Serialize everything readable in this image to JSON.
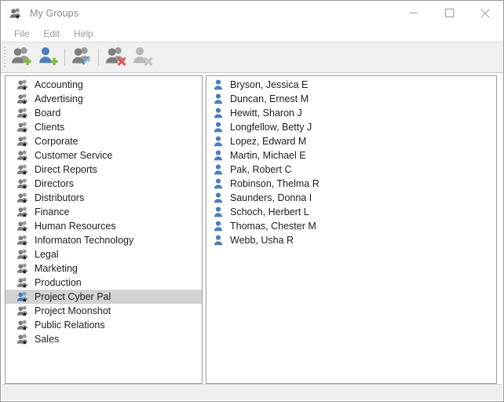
{
  "window": {
    "title": "My Groups",
    "title_icon": "group-star-icon",
    "controls": [
      {
        "name": "minimize-button",
        "glyph": "minimize-icon"
      },
      {
        "name": "maximize-button",
        "glyph": "maximize-icon"
      },
      {
        "name": "close-button",
        "glyph": "close-icon"
      }
    ]
  },
  "menubar": {
    "items": [
      {
        "label": "File"
      },
      {
        "label": "Edit"
      },
      {
        "label": "Help"
      }
    ]
  },
  "toolbar": {
    "buttons": [
      {
        "label": "Add Group",
        "icon": "add-group-icon",
        "enabled": true
      },
      {
        "label": "Add Member",
        "icon": "add-member-icon",
        "enabled": true
      },
      {
        "label": "Edit Group",
        "icon": "edit-group-icon",
        "enabled": true
      },
      {
        "label": "Delete Group",
        "icon": "delete-group-icon",
        "enabled": true
      },
      {
        "label": "Remove Member",
        "icon": "remove-member-icon",
        "enabled": false
      }
    ]
  },
  "groups_panel": {
    "name": "groups-list",
    "selected_index": 15,
    "items": [
      {
        "label": "Accounting"
      },
      {
        "label": "Advertising"
      },
      {
        "label": "Board"
      },
      {
        "label": "Clients"
      },
      {
        "label": "Corporate"
      },
      {
        "label": "Customer Service"
      },
      {
        "label": "Direct Reports"
      },
      {
        "label": "Directors"
      },
      {
        "label": "Distributors"
      },
      {
        "label": "Finance"
      },
      {
        "label": "Human Resources"
      },
      {
        "label": "Informaton Technology"
      },
      {
        "label": "Legal"
      },
      {
        "label": "Marketing"
      },
      {
        "label": "Production"
      },
      {
        "label": "Project Cyber Pal"
      },
      {
        "label": "Project Moonshot"
      },
      {
        "label": "Public Relations"
      },
      {
        "label": "Sales"
      }
    ]
  },
  "members_panel": {
    "name": "members-list",
    "items": [
      {
        "label": "Bryson, Jessica E"
      },
      {
        "label": "Duncan, Ernest M"
      },
      {
        "label": "Hewitt, Sharon J"
      },
      {
        "label": "Longfellow, Betty J"
      },
      {
        "label": "Lopez, Edward M"
      },
      {
        "label": "Martin, Michael E"
      },
      {
        "label": "Pak, Robert C"
      },
      {
        "label": "Robinson, Thelma R"
      },
      {
        "label": "Saunders, Donna I"
      },
      {
        "label": "Schoch, Herbert L"
      },
      {
        "label": "Thomas, Chester M"
      },
      {
        "label": "Webb, Usha R"
      }
    ]
  },
  "colors": {
    "window_border": "#9a9a9a",
    "title_text": "#8a8a8a",
    "menu_text": "#9a9a9a",
    "toolbar_bg": "#f0f0f0",
    "list_text": "#1d1d1d",
    "selection_bg": "#d3d3d3",
    "person_blue": "#4a7ebb",
    "person_gray": "#8c8c8c",
    "plus_green": "#7fba3c",
    "delete_red": "#e05a5a",
    "statusbar_bg": "#efefef"
  }
}
